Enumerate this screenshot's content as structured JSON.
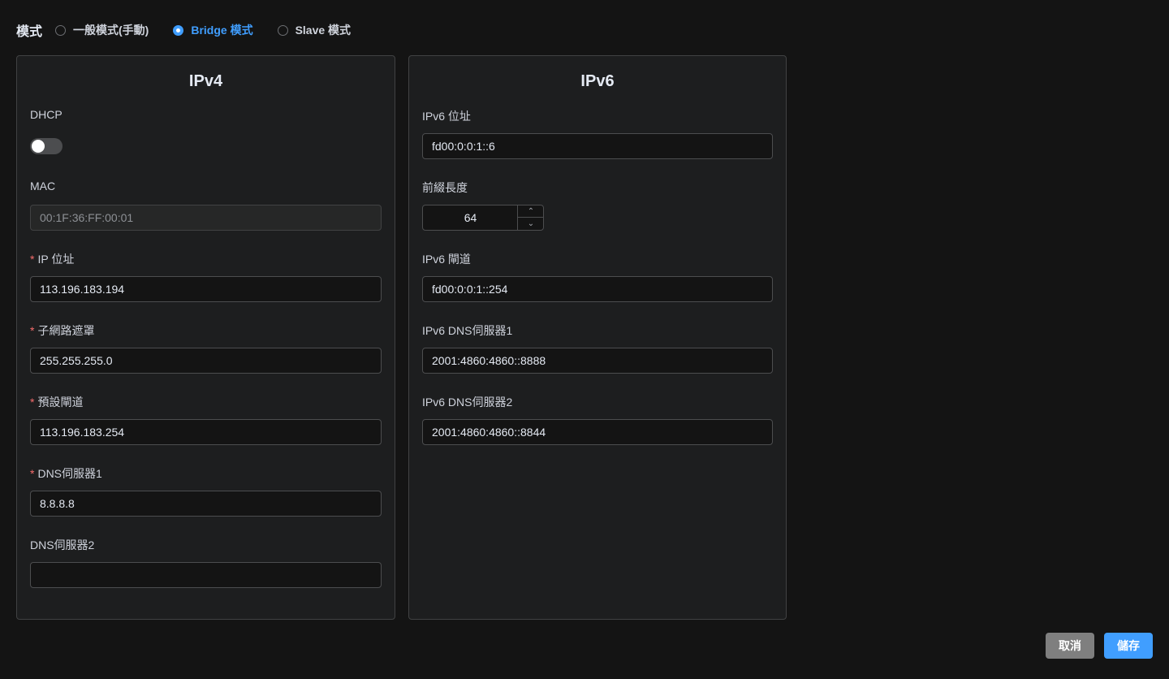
{
  "mode": {
    "label": "模式",
    "options": [
      {
        "label": "一般模式(手動)",
        "checked": false
      },
      {
        "label": "Bridge 模式",
        "checked": true
      },
      {
        "label": "Slave 模式",
        "checked": false
      }
    ]
  },
  "ipv4": {
    "title": "IPv4",
    "dhcp_label": "DHCP",
    "dhcp_enabled": false,
    "mac_label": "MAC",
    "mac_value": "00:1F:36:FF:00:01",
    "ip_label": "IP 位址",
    "ip_value": "113.196.183.194",
    "subnet_label": "子網路遮罩",
    "subnet_value": "255.255.255.0",
    "gateway_label": "預設閘道",
    "gateway_value": "113.196.183.254",
    "dns1_label": "DNS伺服器1",
    "dns1_value": "8.8.8.8",
    "dns2_label": "DNS伺服器2",
    "dns2_value": "",
    "required_mark": "*"
  },
  "ipv6": {
    "title": "IPv6",
    "addr_label": "IPv6 位址",
    "addr_value": "fd00:0:0:1::6",
    "prefix_label": "前綴長度",
    "prefix_value": "64",
    "gateway_label": "IPv6 閘道",
    "gateway_value": "fd00:0:0:1::254",
    "dns1_label": "IPv6 DNS伺服器1",
    "dns1_value": "2001:4860:4860::8888",
    "dns2_label": "IPv6 DNS伺服器2",
    "dns2_value": "2001:4860:4860::8844"
  },
  "actions": {
    "cancel_label": "取消",
    "save_label": "儲存"
  },
  "colors": {
    "accent": "#409eff",
    "required": "#f56c6c",
    "cancel_bg": "#7f7f7f"
  }
}
